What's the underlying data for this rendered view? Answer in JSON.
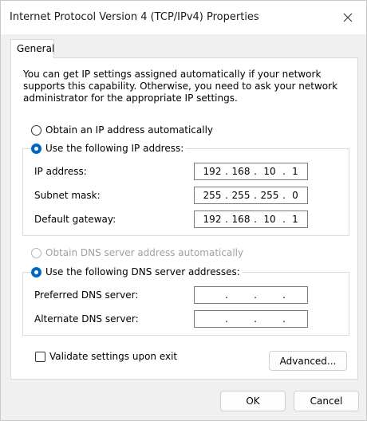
{
  "window": {
    "title": "Internet Protocol Version 4 (TCP/IPv4) Properties"
  },
  "tabs": [
    {
      "label": "General",
      "selected": true
    }
  ],
  "general": {
    "description": "You can get IP settings assigned automatically if your network supports this capability. Otherwise, you need to ask your network administrator for the appropriate IP settings.",
    "ip_mode": {
      "auto_label": "Obtain an IP address automatically",
      "auto_selected": false,
      "manual_label": "Use the following IP address:",
      "manual_selected": true
    },
    "ip_fields": [
      {
        "label": "IP address:",
        "octets": [
          "192",
          "168",
          "10",
          "1"
        ]
      },
      {
        "label": "Subnet mask:",
        "octets": [
          "255",
          "255",
          "255",
          "0"
        ]
      },
      {
        "label": "Default gateway:",
        "octets": [
          "192",
          "168",
          "10",
          "1"
        ]
      }
    ],
    "dns_mode": {
      "auto_label": "Obtain DNS server address automatically",
      "auto_selected": false,
      "auto_disabled": true,
      "manual_label": "Use the following DNS server addresses:",
      "manual_selected": true
    },
    "dns_fields": [
      {
        "label": "Preferred DNS server:",
        "octets": [
          "",
          "",
          "",
          ""
        ]
      },
      {
        "label": "Alternate DNS server:",
        "octets": [
          "",
          "",
          "",
          ""
        ]
      }
    ],
    "validate_label": "Validate settings upon exit",
    "validate_checked": false,
    "advanced_label": "Advanced..."
  },
  "footer": {
    "ok_label": "OK",
    "cancel_label": "Cancel"
  },
  "colors": {
    "accent": "#0067c0",
    "background": "#f0f0f0"
  },
  "separator": "."
}
